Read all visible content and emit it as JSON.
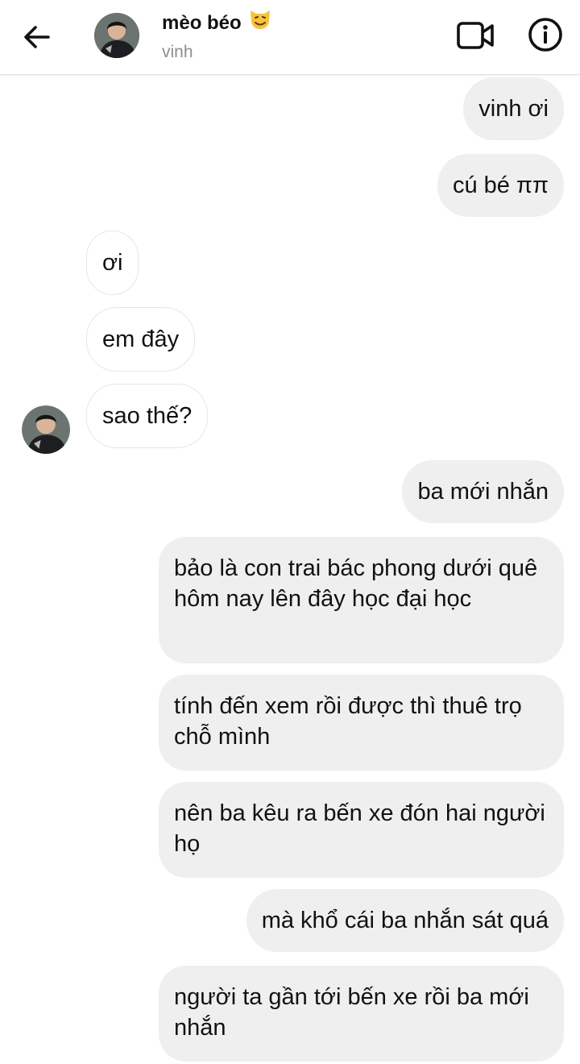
{
  "header": {
    "name": "mèo béo",
    "name_emoji": "cat-face-emoji",
    "username": "vinh",
    "icons": [
      "back-arrow-icon",
      "video-call-icon",
      "info-icon"
    ]
  },
  "messages": [
    {
      "side": "out",
      "text": "vinh ơi"
    },
    {
      "side": "out",
      "text": "cú bé ππ"
    },
    {
      "side": "in",
      "text": "ơi"
    },
    {
      "side": "in",
      "text": "em đây"
    },
    {
      "side": "in",
      "text": "sao thế?"
    },
    {
      "side": "out",
      "text": "ba mới nhắn"
    },
    {
      "side": "out",
      "text": "bảo là con trai bác phong dưới quê hôm nay lên đây học đại học"
    },
    {
      "side": "out",
      "text": "tính đến xem rồi được thì thuê trọ chỗ mình"
    },
    {
      "side": "out",
      "text": "nên ba kêu ra bến xe đón hai người họ"
    },
    {
      "side": "out",
      "text": "mà khổ cái ba nhắn sát quá"
    },
    {
      "side": "out",
      "text": "người ta gần tới bến xe rồi ba mới nhắn"
    }
  ],
  "colors": {
    "outgoing_bubble": "#efefef",
    "incoming_border": "#e6e6e6",
    "username_gray": "#8e8e8e"
  }
}
